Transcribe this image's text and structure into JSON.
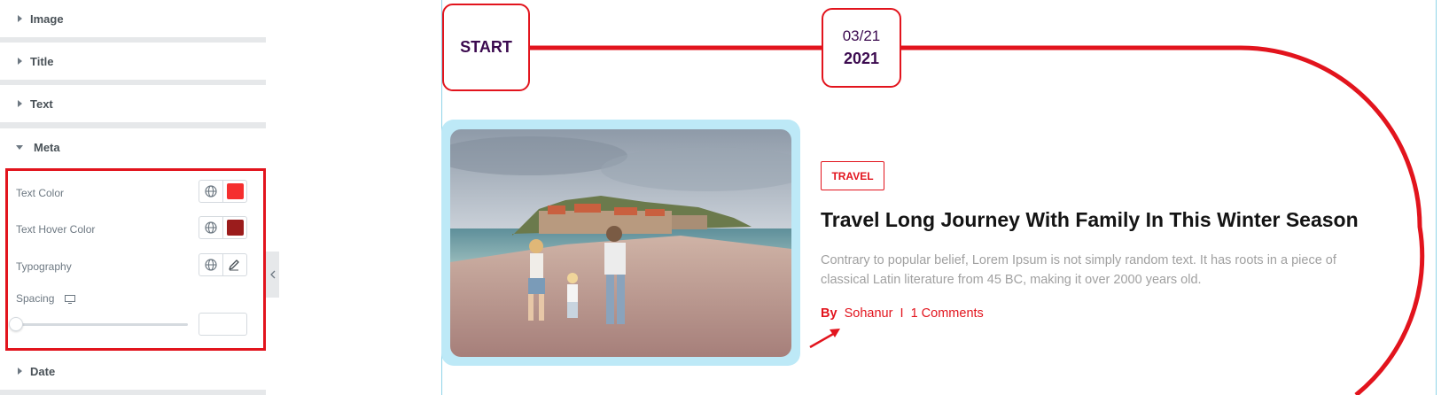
{
  "panel": {
    "sections": {
      "image": "Image",
      "title": "Title",
      "text": "Text",
      "meta": "Meta",
      "date": "Date"
    },
    "meta_controls": {
      "text_color_label": "Text Color",
      "text_color_value": "#f52f2f",
      "text_hover_color_label": "Text Hover Color",
      "text_hover_color_value": "#9b1c1c",
      "typography_label": "Typography",
      "spacing_label": "Spacing",
      "spacing_value": "",
      "spacing_level": 0
    },
    "highlight_color": "#e2141d"
  },
  "timeline": {
    "start_label": "START",
    "date_month_day": "03/21",
    "date_year": "2021",
    "line_color": "#e2141d"
  },
  "post": {
    "image_icon": "family-beach-photo",
    "category": "TRAVEL",
    "title": "Travel Long Journey With Family In This Winter Season",
    "excerpt": "Contrary to popular belief, Lorem Ipsum is not simply random text. It has roots in a piece of classical Latin literature from 45 BC, making it over 2000 years old.",
    "by": "By",
    "author": "Sohanur",
    "separator": "I",
    "comments": "1 Comments"
  }
}
